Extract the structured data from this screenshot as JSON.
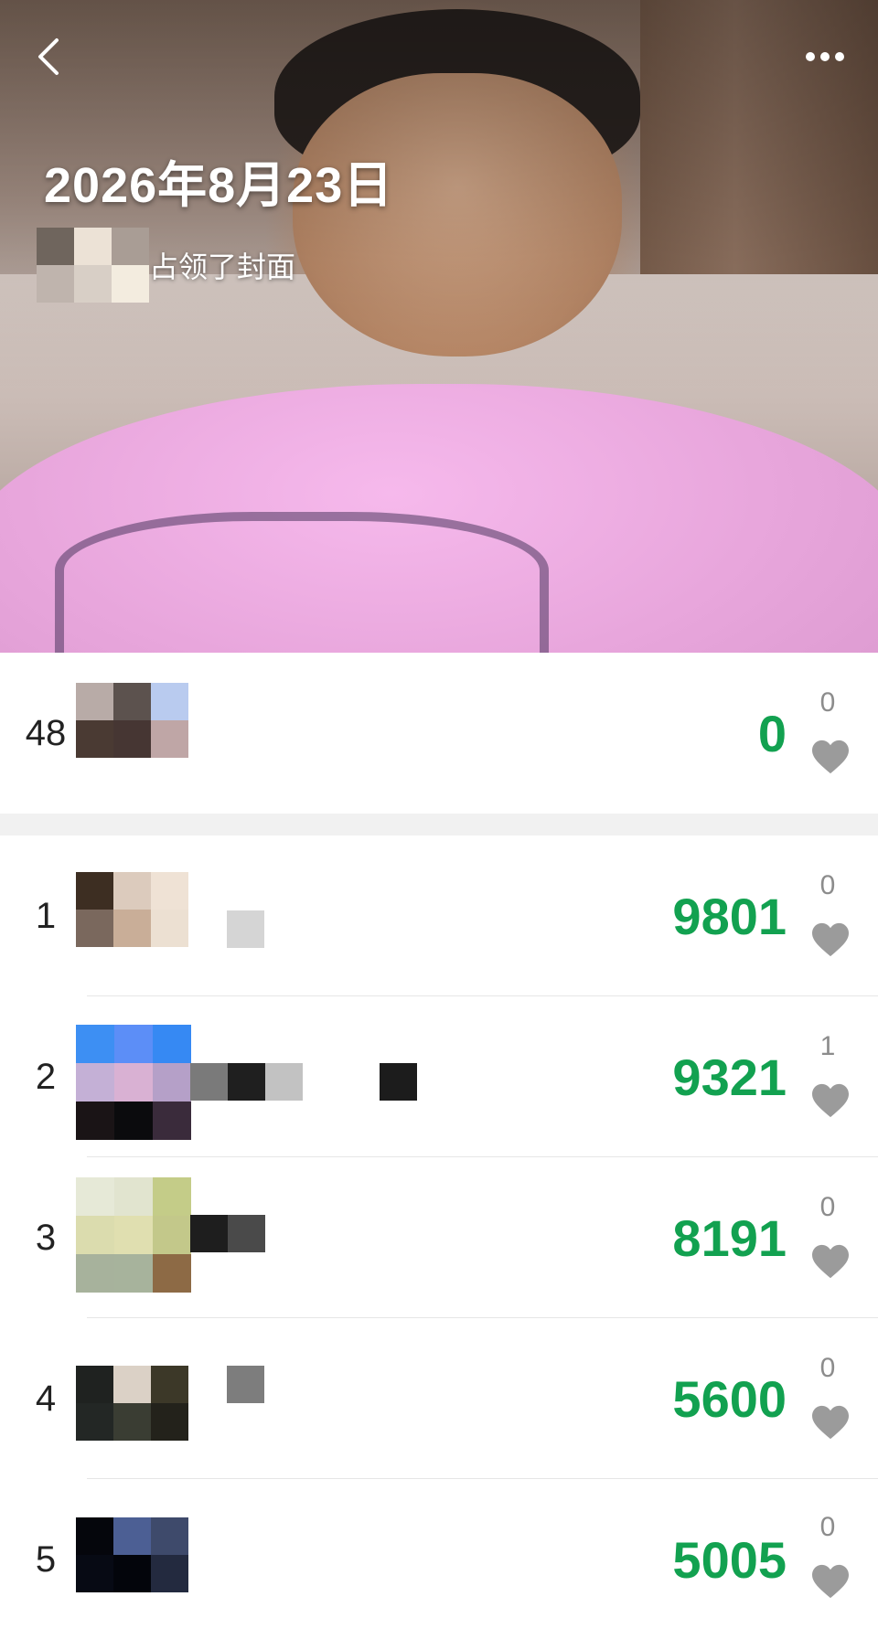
{
  "nav": {
    "back_icon": "chevron-left-icon",
    "more_icon": "more-horizontal-icon"
  },
  "cover": {
    "date": "2026年8月23日",
    "caption": "占领了封面"
  },
  "self_entry": {
    "rank": "48",
    "steps": "0",
    "likes": "0"
  },
  "ranking": [
    {
      "rank": "1",
      "steps": "9801",
      "likes": "0"
    },
    {
      "rank": "2",
      "steps": "9321",
      "likes": "1"
    },
    {
      "rank": "3",
      "steps": "8191",
      "likes": "0"
    },
    {
      "rank": "4",
      "steps": "5600",
      "likes": "0"
    },
    {
      "rank": "5",
      "steps": "5005",
      "likes": "0"
    }
  ],
  "colors": {
    "steps": "#12a150",
    "like_icon": "#9b9b9b"
  }
}
